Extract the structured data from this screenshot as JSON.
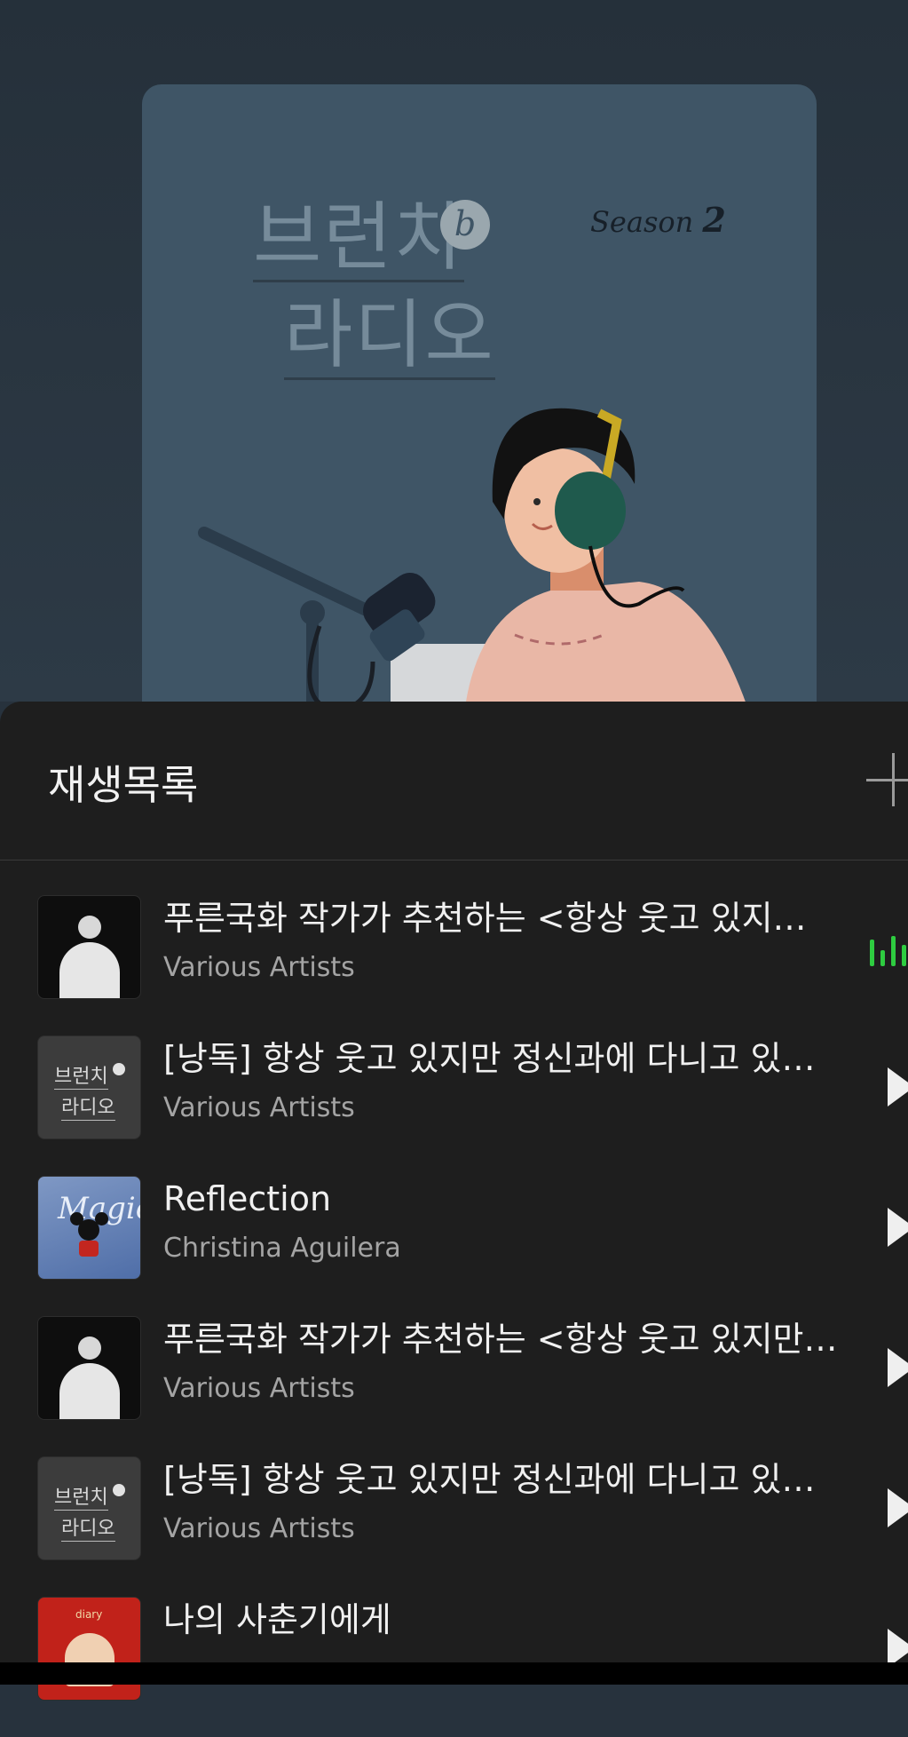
{
  "cover": {
    "title_line1": "브런치",
    "title_line2": "라디오",
    "badge": "b",
    "season_label": "Season",
    "season_number": "2"
  },
  "playlist": {
    "title": "재생목록"
  },
  "tracks": [
    {
      "title": "푸른국화 작가가 추천하는 <항상 웃고 있지…",
      "artist": "Various Artists",
      "state": "playing"
    },
    {
      "title": "[낭독] 항상 웃고 있지만 정신과에 다니고 있…",
      "artist": "Various Artists",
      "state": "paused"
    },
    {
      "title": "Reflection",
      "artist": "Christina Aguilera",
      "state": "paused"
    },
    {
      "title": "푸른국화 작가가 추천하는 <항상 웃고 있지만…",
      "artist": "Various Artists",
      "state": "paused"
    },
    {
      "title": "[낭독] 항상 웃고 있지만 정신과에 다니고 있…",
      "artist": "Various Artists",
      "state": "paused"
    },
    {
      "title": "나의 사춘기에게",
      "artist": "",
      "state": "paused"
    }
  ],
  "thumbs": {
    "logo_line1": "브런치",
    "logo_line2": "라디오",
    "disney_text": "Magic",
    "red_text": "diary"
  },
  "colors": {
    "accent_playing": "#2ecc40",
    "sheet_background": "#1e1e1e",
    "cover_background": "#3f5566"
  }
}
